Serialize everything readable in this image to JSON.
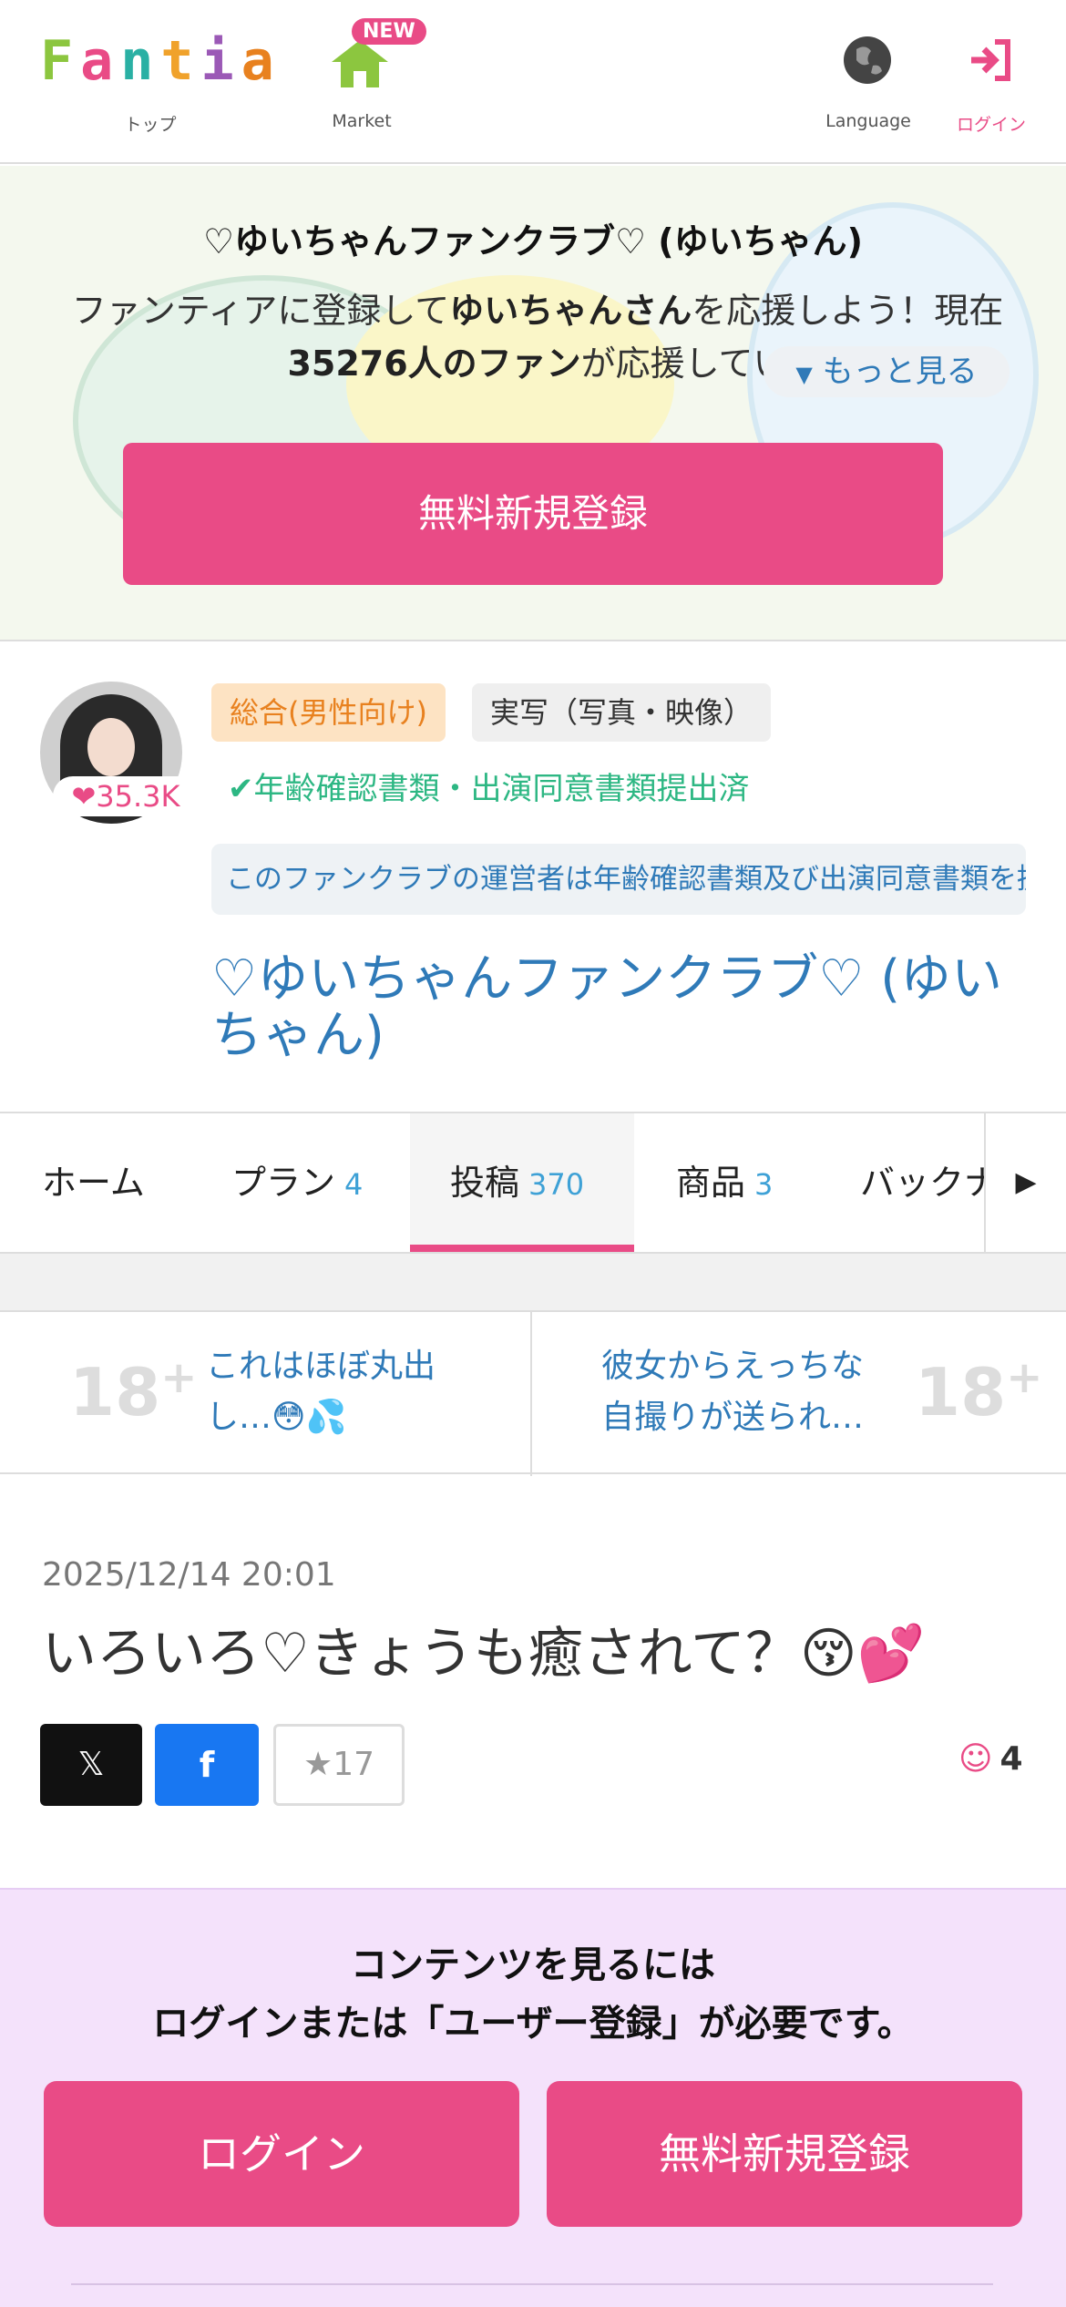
{
  "header": {
    "logo_letters": [
      "F",
      "a",
      "n",
      "t",
      "i",
      "a"
    ],
    "logo_colors": [
      "#8cc63f",
      "#e94b86",
      "#2ab0a4",
      "#f0a22b",
      "#9b59b6",
      "#e8811f"
    ],
    "top_label": "トップ",
    "market_label": "Market",
    "new_badge": "NEW",
    "language_label": "Language",
    "login_label": "ログイン"
  },
  "hero": {
    "title": "♡ゆいちゃんファンクラブ♡ (ゆいちゃん󠄀󠄀)",
    "text_pre": "ファンティアに登録して",
    "text_name": "ゆいちゃん󠄀󠄀さん",
    "text_mid": "を応援しよう！現在",
    "text_fans": "35276人のファン",
    "text_post": "が応援してい",
    "more_label": "もっと見る",
    "signup_label": "無料新規登録"
  },
  "profile": {
    "heart_count": "35.3K",
    "tag_category": "総合(男性向け)",
    "tag_type": "実写（写真・映像）",
    "verified_text": "年齢確認書類・出演同意書類提出済",
    "notice": "このファンクラブの運営者は年齢確認書類及び出演同意書類を提出済みです",
    "club_name": "♡ゆいちゃんファンクラブ♡ (ゆいちゃん󠄀󠄀)"
  },
  "tabs": [
    {
      "label": "ホーム",
      "count": ""
    },
    {
      "label": "プラン",
      "count": "4"
    },
    {
      "label": "投稿",
      "count": "370"
    },
    {
      "label": "商品",
      "count": "3"
    },
    {
      "label": "バックナンバー",
      "count": ""
    }
  ],
  "related": {
    "left_badge": "18",
    "left_title_1": "これはほぼ丸出",
    "left_title_2": "し…😳💦",
    "right_badge": "18",
    "right_title_1": "彼女からえっちな",
    "right_title_2": "自撮りが送られ…"
  },
  "post": {
    "date": "2025/12/14 20:01",
    "title": "いろいろ♡きょうも癒されて？😚💕",
    "x_label": "𝕏",
    "fb_label": "f",
    "fav_count": "17",
    "reaction_count": "4"
  },
  "login_prompt": {
    "line1": "コンテンツを見るには",
    "line2": "ログインまたは「ユーザー登録」が必要です。",
    "login_button": "ログイン",
    "signup_button": "無料新規登録"
  },
  "colors": {
    "accent": "#e94b86",
    "link": "#2f7ab8",
    "verified": "#2db783"
  }
}
